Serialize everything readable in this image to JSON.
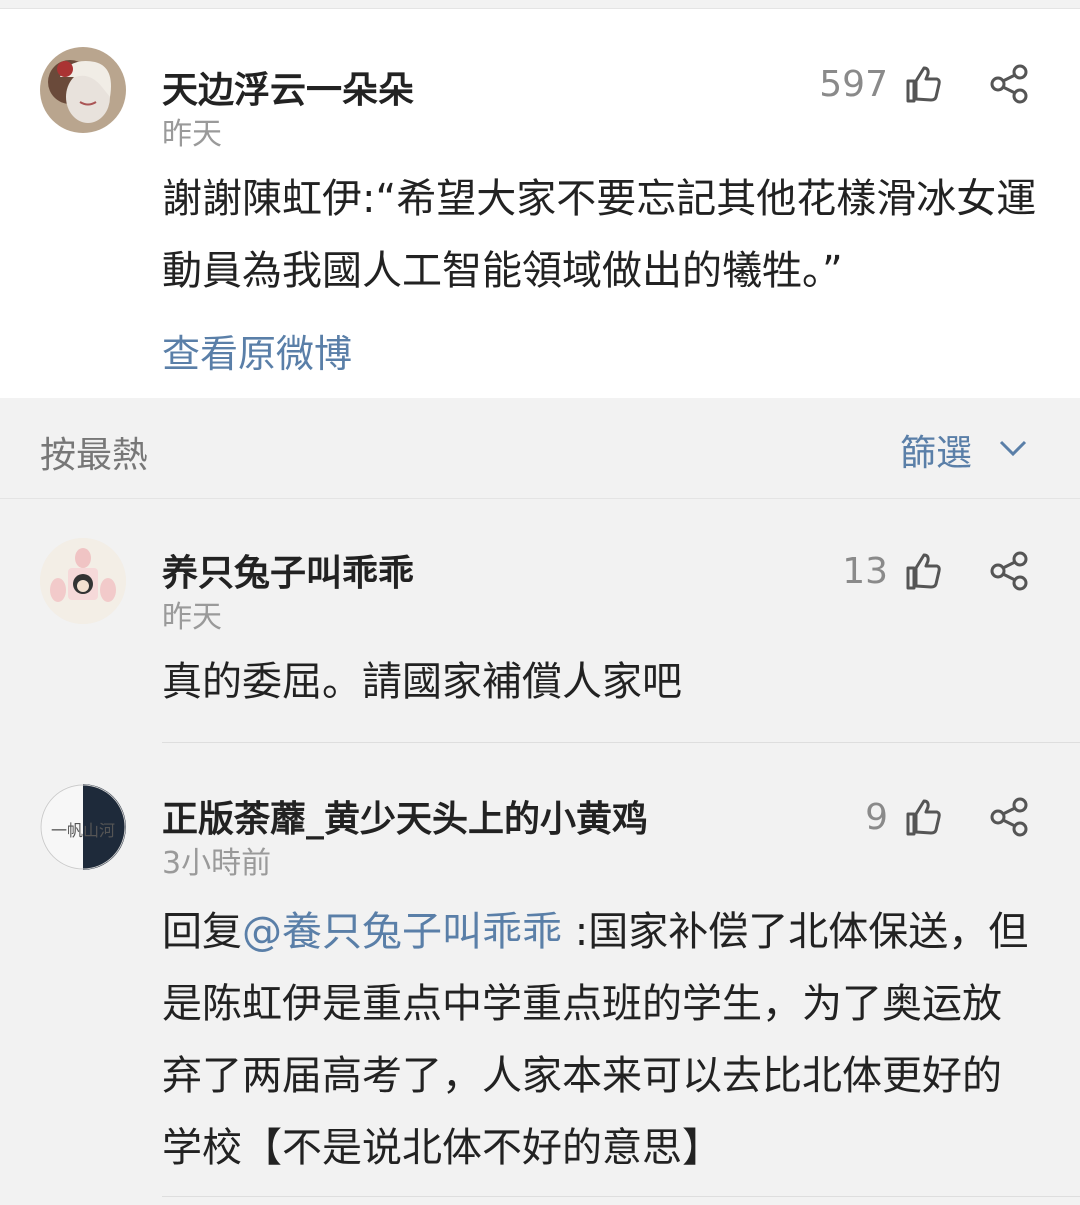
{
  "main_comment": {
    "username": "天边浮云一朵朵",
    "time": "昨天",
    "likes": "597",
    "text": "謝謝陳虹伊:“希望大家不要忘記其他花樣滑冰女運動員為我國人工智能領域做出的犧牲。”",
    "view_original": "查看原微博"
  },
  "sort_bar": {
    "sort_label": "按最熱",
    "filter_label": "篩選"
  },
  "replies": [
    {
      "username": "养只兔子叫乖乖",
      "time": "昨天",
      "likes": "13",
      "text": "真的委屈。請國家補償人家吧"
    },
    {
      "username": "正版荼蘼_黄少天头上的小黄鸡",
      "time": "3小時前",
      "likes": "9",
      "reply_prefix": "回复",
      "mention": "@養只兔子叫乖乖",
      "text": " :国家补偿了北体保送，但是陈虹伊是重点中学重点班的学生，为了奥运放弃了两届高考了，人家本来可以去比北体更好的学校【不是说北体不好的意思】"
    }
  ],
  "avatar_text": "一帆山河",
  "colors": {
    "link": "#5a7fa8",
    "muted": "#9a9a9a",
    "background": "#f2f2f2"
  },
  "icons": [
    "thumbs-up-icon",
    "share-icon",
    "chevron-down-icon"
  ]
}
